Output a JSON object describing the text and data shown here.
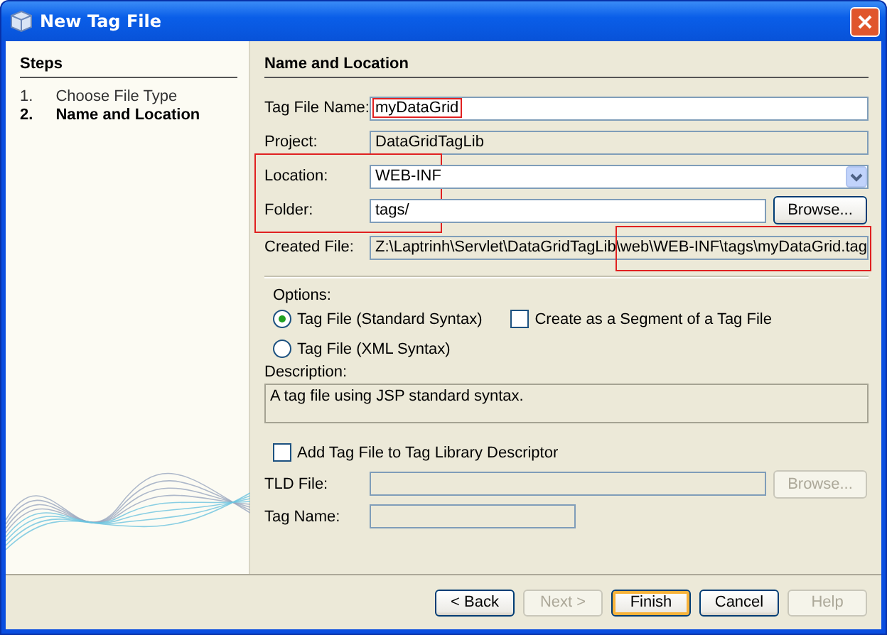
{
  "window": {
    "title": "New Tag File"
  },
  "steps": {
    "title": "Steps",
    "items": [
      {
        "number": "1.",
        "label": "Choose File Type",
        "selected": false
      },
      {
        "number": "2.",
        "label": "Name and Location",
        "selected": true
      }
    ]
  },
  "panel": {
    "title": "Name and Location"
  },
  "fields": [
    {
      "kind": "text",
      "label": "Tag File Name:",
      "value": "myDataGrid",
      "highlighted": true
    },
    {
      "kind": "readonly",
      "label": "Project:",
      "value": "DataGridTagLib"
    },
    {
      "kind": "combo",
      "label": "Location:",
      "value": "WEB-INF"
    },
    {
      "kind": "text",
      "label": "Folder:",
      "value": "tags/",
      "button": "Browse..."
    },
    {
      "kind": "readonly",
      "label": "Created File:",
      "value": "Z:\\Laptrinh\\Servlet\\DataGridTagLib\\web\\WEB-INF\\tags\\myDataGrid.tag"
    }
  ],
  "options": {
    "label": "Options:",
    "radios": [
      {
        "label": "Tag File (Standard Syntax)",
        "selected": true
      },
      {
        "label": "Tag File (XML Syntax)",
        "selected": false
      }
    ],
    "segment_checkbox": {
      "label": "Create as a Segment of a Tag File",
      "checked": false
    }
  },
  "description": {
    "label": "Description:",
    "text": "A tag file using JSP standard syntax."
  },
  "tld": {
    "checkbox": {
      "label": "Add Tag File to Tag Library Descriptor",
      "checked": false
    },
    "fields": [
      {
        "label": "TLD File:",
        "disabled": true,
        "button": "Browse..."
      },
      {
        "label": "Tag Name:",
        "disabled": true
      }
    ]
  },
  "buttons": [
    {
      "label": "< Back",
      "disabled": false,
      "default": false
    },
    {
      "label": "Next >",
      "disabled": true,
      "default": false
    },
    {
      "label": "Finish",
      "disabled": false,
      "default": true
    },
    {
      "label": "Cancel",
      "disabled": false,
      "default": false
    },
    {
      "label": "Help",
      "disabled": true,
      "default": false
    }
  ]
}
